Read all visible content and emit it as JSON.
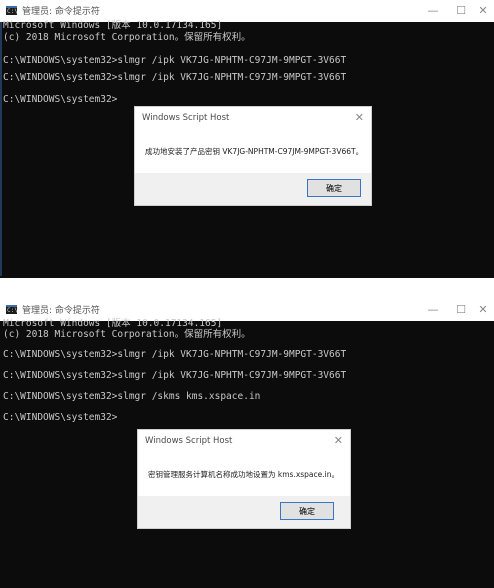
{
  "window1": {
    "title": "管理员: 命令提示符",
    "controls": {
      "minimize": "—",
      "maximize": "☐",
      "close": "✕"
    },
    "lines": [
      "Microsoft Windows [版本 10.0.17134.165]",
      "(c) 2018 Microsoft Corporation。保留所有权利。",
      "C:\\WINDOWS\\system32>slmgr /ipk VK7JG-NPHTM-C97JM-9MPGT-3V66T",
      "C:\\WINDOWS\\system32>slmgr /ipk VK7JG-NPHTM-C97JM-9MPGT-3V66T",
      "C:\\WINDOWS\\system32>"
    ],
    "dialog": {
      "title": "Windows Script Host",
      "message": "成功地安装了产品密钥 VK7JG-NPHTM-C97JM-9MPGT-3V66T。",
      "ok_label": "确定",
      "close_glyph": "✕"
    }
  },
  "window2": {
    "title": "管理员: 命令提示符",
    "controls": {
      "minimize": "—",
      "maximize": "☐",
      "close": "✕"
    },
    "lines": [
      "Microsoft Windows [版本 10.0.17134.165]",
      "(c) 2018 Microsoft Corporation。保留所有权利。",
      "C:\\WINDOWS\\system32>slmgr /ipk VK7JG-NPHTM-C97JM-9MPGT-3V66T",
      "C:\\WINDOWS\\system32>slmgr /ipk VK7JG-NPHTM-C97JM-9MPGT-3V66T",
      "C:\\WINDOWS\\system32>slmgr /skms kms.xspace.in",
      "C:\\WINDOWS\\system32>"
    ],
    "dialog": {
      "title": "Windows Script Host",
      "message": "密钥管理服务计算机名称成功地设置为 kms.xspace.in。",
      "ok_label": "确定",
      "close_glyph": "✕"
    }
  }
}
